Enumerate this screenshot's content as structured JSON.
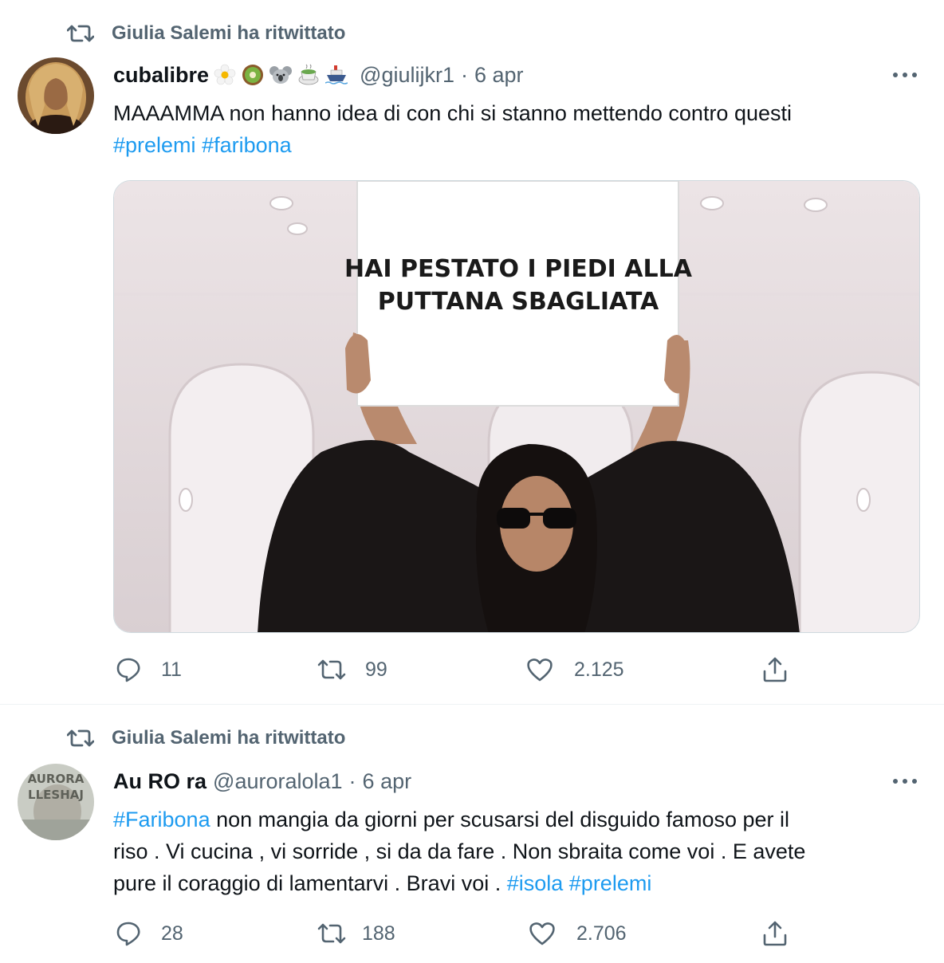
{
  "tweets": [
    {
      "retweet_label": "Giulia Salemi ha ritwittato",
      "author_name": "cubalibre",
      "author_emojis": [
        "flower-emoji",
        "kiwi-emoji",
        "koala-emoji",
        "matcha-emoji",
        "ship-emoji"
      ],
      "handle": "@giulijkr1",
      "separator": "·",
      "date": "6 apr",
      "text_line1": "MAAAMMA non hanno idea di con chi si stanno mettendo contro questi",
      "hashtags": [
        "#prelemi",
        "#faribona"
      ],
      "media": {
        "sign_line1": "HAI PESTATO I PIEDI ALLA",
        "sign_line2": "PUTTANA SBAGLIATA"
      },
      "replies": "11",
      "retweets": "99",
      "likes": "2.125"
    },
    {
      "retweet_label": "Giulia Salemi ha ritwittato",
      "author_name": "Au RO ra",
      "handle": "@auroralola1",
      "separator": "·",
      "date": "6 apr",
      "avatar_text_1": "AURORA",
      "avatar_text_2": "LLESHAJ",
      "text": {
        "tag1": "#Faribona",
        "part1": " non mangia da giorni per scusarsi del disguido famoso per il",
        "line2": "riso . Vi cucina , vi sorride , si da da fare . Non sbraita come voi . E avete",
        "line3": "pure il coraggio di lamentarvi . Bravi voi . ",
        "tag2": "#isola",
        "tag3": "#prelemi"
      },
      "replies": "28",
      "retweets": "188",
      "likes": "2.706"
    }
  ],
  "colors": {
    "text": "#0f1419",
    "secondary": "#536471",
    "link": "#1d9bf0",
    "border": "#cfd9de"
  }
}
